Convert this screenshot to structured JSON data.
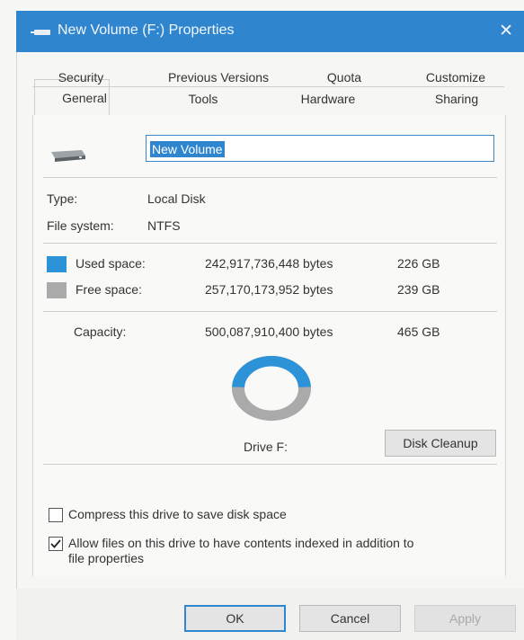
{
  "window": {
    "title": "New Volume (F:) Properties",
    "close_glyph": "✕"
  },
  "tabs_row1": [
    "Security",
    "Previous Versions",
    "Quota",
    "Customize"
  ],
  "tabs_row2": [
    "General",
    "Tools",
    "Hardware",
    "Sharing"
  ],
  "active_tab": "General",
  "volume_name": "New Volume",
  "type": {
    "label": "Type:",
    "value": "Local Disk"
  },
  "file_system": {
    "label": "File system:",
    "value": "NTFS"
  },
  "used": {
    "label": "Used space:",
    "bytes": "242,917,736,448 bytes",
    "size": "226 GB",
    "color": "#2c93d8"
  },
  "free": {
    "label": "Free space:",
    "bytes": "257,170,173,952 bytes",
    "size": "239 GB",
    "color": "#aaaaaa"
  },
  "capacity": {
    "label": "Capacity:",
    "bytes": "500,087,910,400 bytes",
    "size": "465 GB"
  },
  "used_fraction": 0.486,
  "drive_label": "Drive F:",
  "disk_cleanup_label": "Disk Cleanup",
  "options": {
    "compress": {
      "label": "Compress this drive to save disk space",
      "checked": false
    },
    "index_line1": "Allow files on this drive to have contents indexed in addition to",
    "index_line2": "file properties",
    "index_checked": true
  },
  "buttons": {
    "ok": "OK",
    "cancel": "Cancel",
    "apply": "Apply"
  },
  "colors": {
    "title_bar": "#2f86cf",
    "accent": "#2f86cf"
  },
  "icons": {
    "window_icon": "drive-icon",
    "close": "close-icon"
  }
}
